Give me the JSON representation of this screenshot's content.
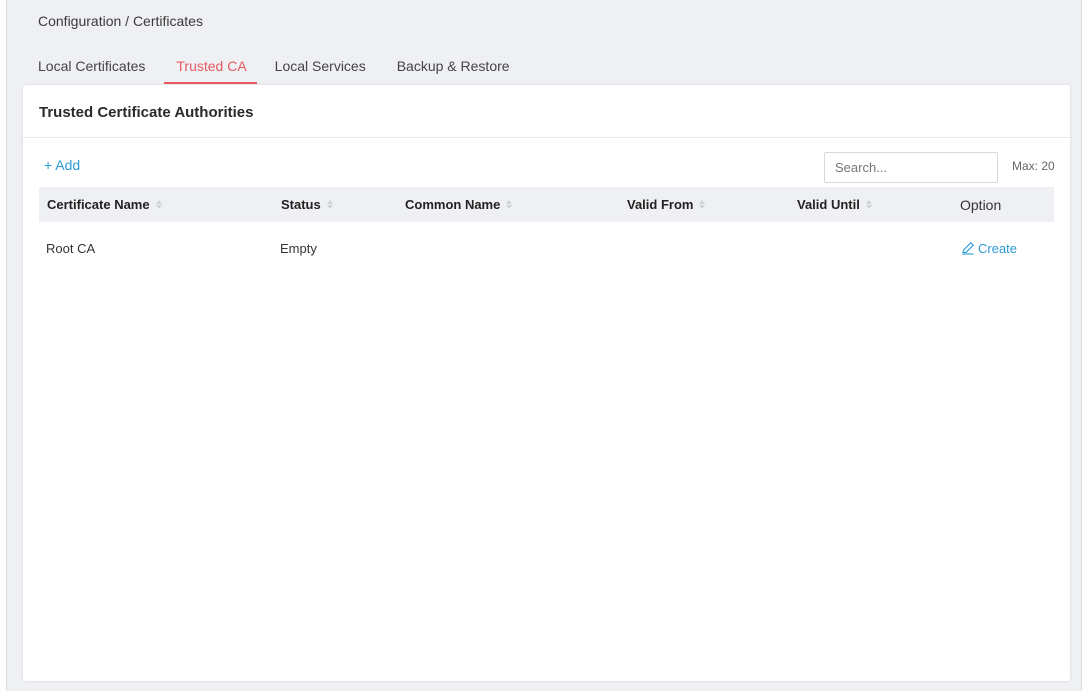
{
  "breadcrumb": "Configuration / Certificates",
  "tabs": [
    {
      "label": "Local Certificates",
      "active": false
    },
    {
      "label": "Trusted CA",
      "active": true
    },
    {
      "label": "Local Services",
      "active": false
    },
    {
      "label": "Backup & Restore",
      "active": false
    }
  ],
  "card": {
    "title": "Trusted Certificate Authorities",
    "add_label": "+ Add",
    "search_placeholder": "Search...",
    "max_label": "Max: 20"
  },
  "table": {
    "columns": [
      "Certificate Name",
      "Status",
      "Common Name",
      "Valid From",
      "Valid Until",
      "Option"
    ],
    "rows": [
      {
        "certificate_name": "Root CA",
        "status": "Empty",
        "common_name": "",
        "valid_from": "",
        "valid_until": "",
        "option_label": "Create",
        "option_icon": "pencil-icon"
      }
    ]
  },
  "colors": {
    "accent_tab": "#e85a63",
    "link": "#2b9bd6"
  }
}
